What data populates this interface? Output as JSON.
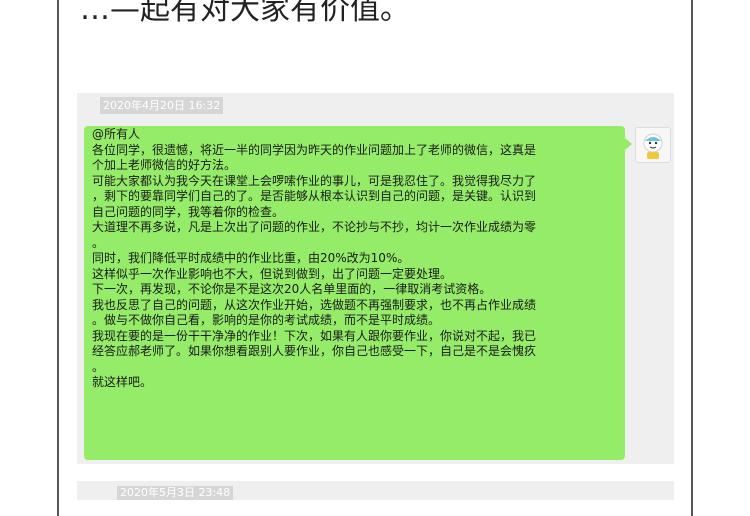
{
  "headline": "…—起有对大家有价值。",
  "messages": [
    {
      "timestamp": "2020年4月20日 16:32",
      "lines": [
        "@所有人",
        "各位同学，很遗憾，将近一半的同学因为昨天的作业问题加上了老师的微信，这真是",
        "个加上老师微信的好方法。",
        "可能大家都认为我今天在课堂上会啰嗦作业的事儿，可是我忍住了。我觉得我尽力了",
        "，剩下的要靠同学们自己的了。是否能够从根本认识到自己的问题，是关键。认识到",
        "自己问题的同学，我等着你的检查。",
        "大道理不再多说，凡是上次出了问题的作业，不论抄与不抄，均计一次作业成绩为零",
        "。",
        "同时，我们降低平时成绩中的作业比重，由20%改为10%。",
        "这样似乎一次作业影响也不大，但说到做到，出了问题一定要处理。",
        "下一次，再发现，不论你是不是这次20人名单里面的，一律取消考试资格。",
        "我也反思了自己的问题，从这次作业开始，选做题不再强制要求，也不再占作业成绩",
        "。做与不做你自己看，影响的是你的考试成绩，而不是平时成绩。",
        "我现在要的是一份干干净净的作业！下次，如果有人跟你要作业，你说对不起，我已",
        "经答应郝老师了。如果你想看跟别人要作业，你自己也感受一下，自己是不是会愧疚",
        "。",
        "就这样吧。"
      ]
    },
    {
      "timestamp": "2020年5月3日 23:48"
    }
  ],
  "colors": {
    "bubble": "#95ec69",
    "chat_background": "#efefef",
    "timestamp_background": "#d6d6d6"
  },
  "icons": {
    "avatar": "cartoon-avatar-icon"
  }
}
